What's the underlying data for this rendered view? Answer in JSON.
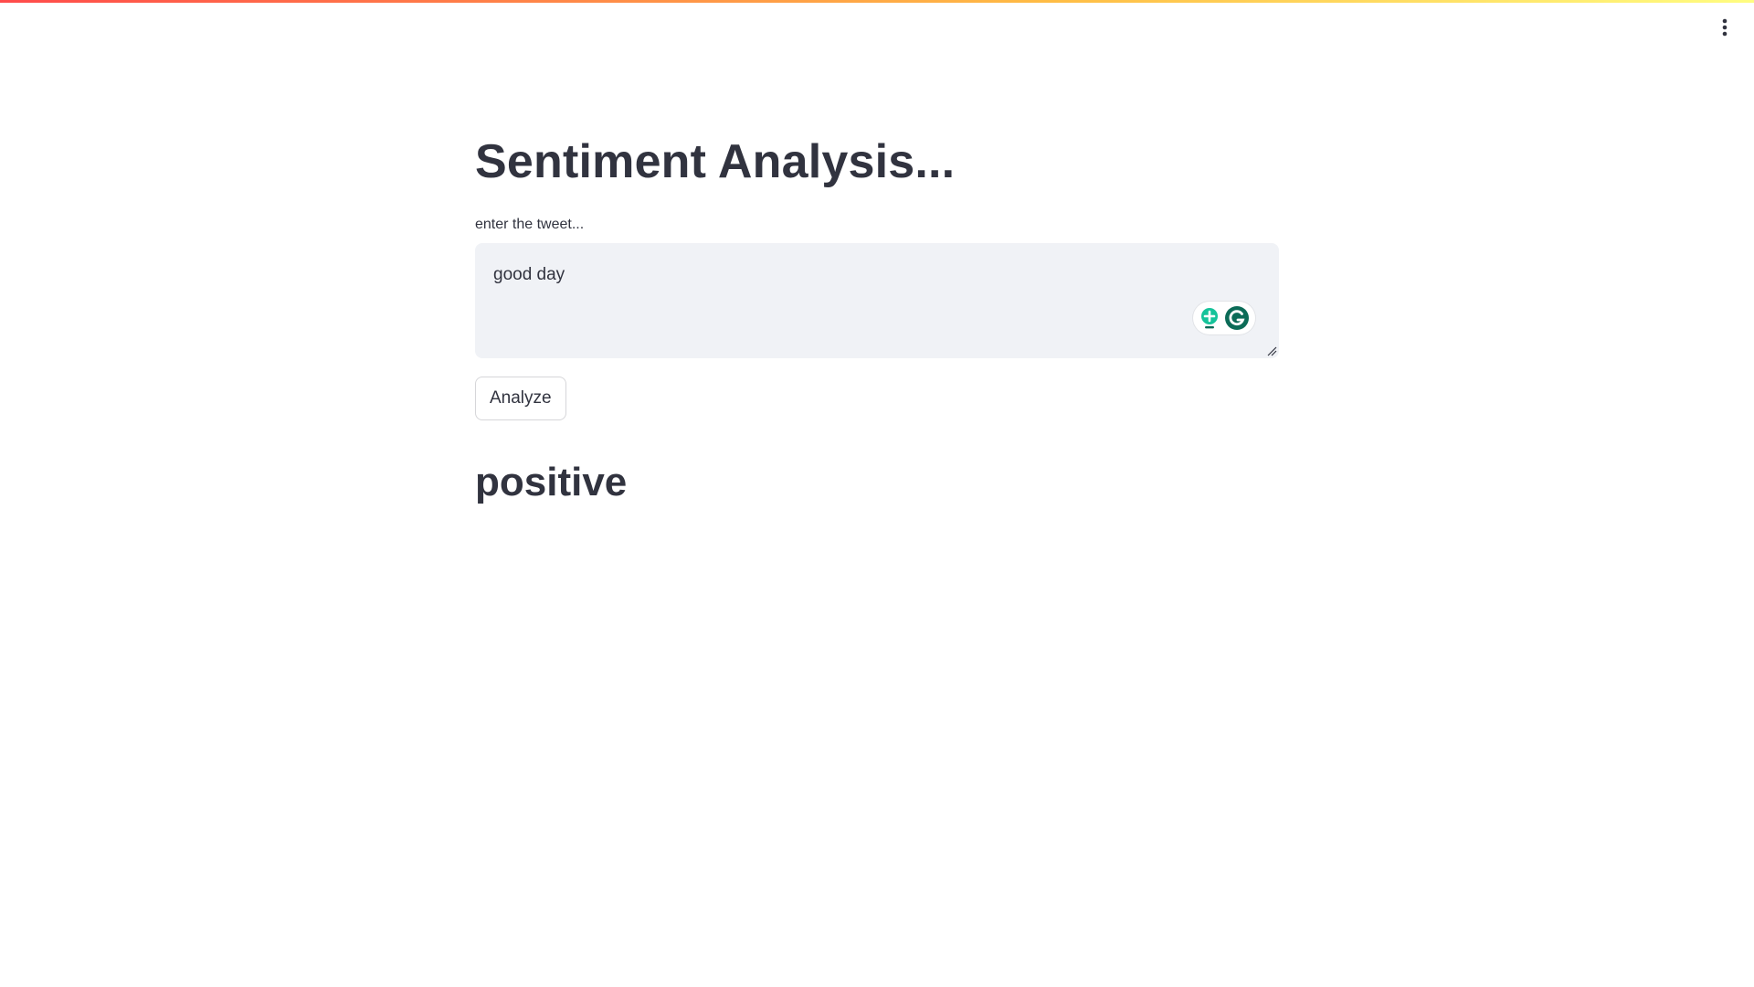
{
  "app": {
    "title": "Sentiment Analysis...",
    "menu_icon": "kebab-vertical-icon"
  },
  "form": {
    "label": "enter the tweet...",
    "textarea_value": "good day",
    "button_label": "Analyze",
    "grammarly_icons": [
      "grammarly-suggestion-icon",
      "grammarly-logo-icon"
    ]
  },
  "result": {
    "label": "positive"
  },
  "colors": {
    "text": "#31333f",
    "input_bg": "#f0f2f6",
    "grammarly_green": "#15c39a",
    "grammarly_dark": "#0b6b57",
    "accent_red": "#ff4b4b",
    "accent_yellow": "#fffd80"
  }
}
